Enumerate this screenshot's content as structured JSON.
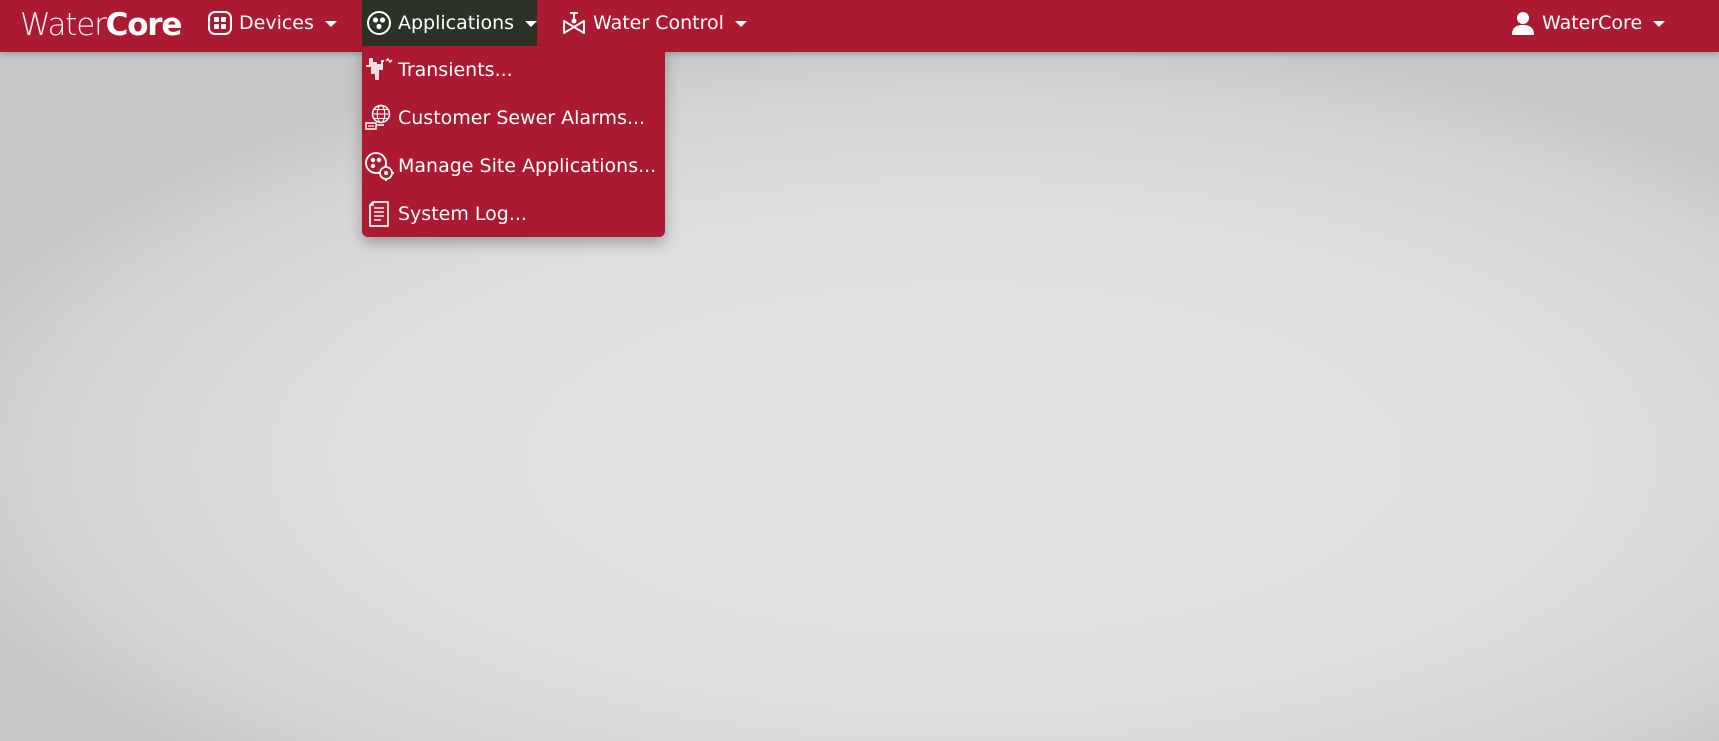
{
  "brand": {
    "light": "Water",
    "bold": "Core"
  },
  "nav": {
    "devices": {
      "label": "Devices",
      "icon": "devices-grid-icon"
    },
    "applications": {
      "label": "Applications",
      "icon": "applications-circle-icon",
      "expanded": true
    },
    "water_control": {
      "label": "Water Control",
      "icon": "valve-icon"
    },
    "user": {
      "label": "WaterCore",
      "icon": "user-icon"
    }
  },
  "applications_menu": {
    "items": [
      {
        "label": "Transients...",
        "icon": "transients-waveform-icon"
      },
      {
        "label": "Customer Sewer Alarms...",
        "icon": "sewer-alarm-globe-icon"
      },
      {
        "label": "Manage Site Applications...",
        "icon": "manage-applications-gear-icon"
      },
      {
        "label": "System Log...",
        "icon": "system-log-document-icon"
      }
    ]
  },
  "colors": {
    "navbar": "#ab1a30",
    "active_nav": "#2c3326",
    "background": "#dedede",
    "text": "#ffffff"
  }
}
